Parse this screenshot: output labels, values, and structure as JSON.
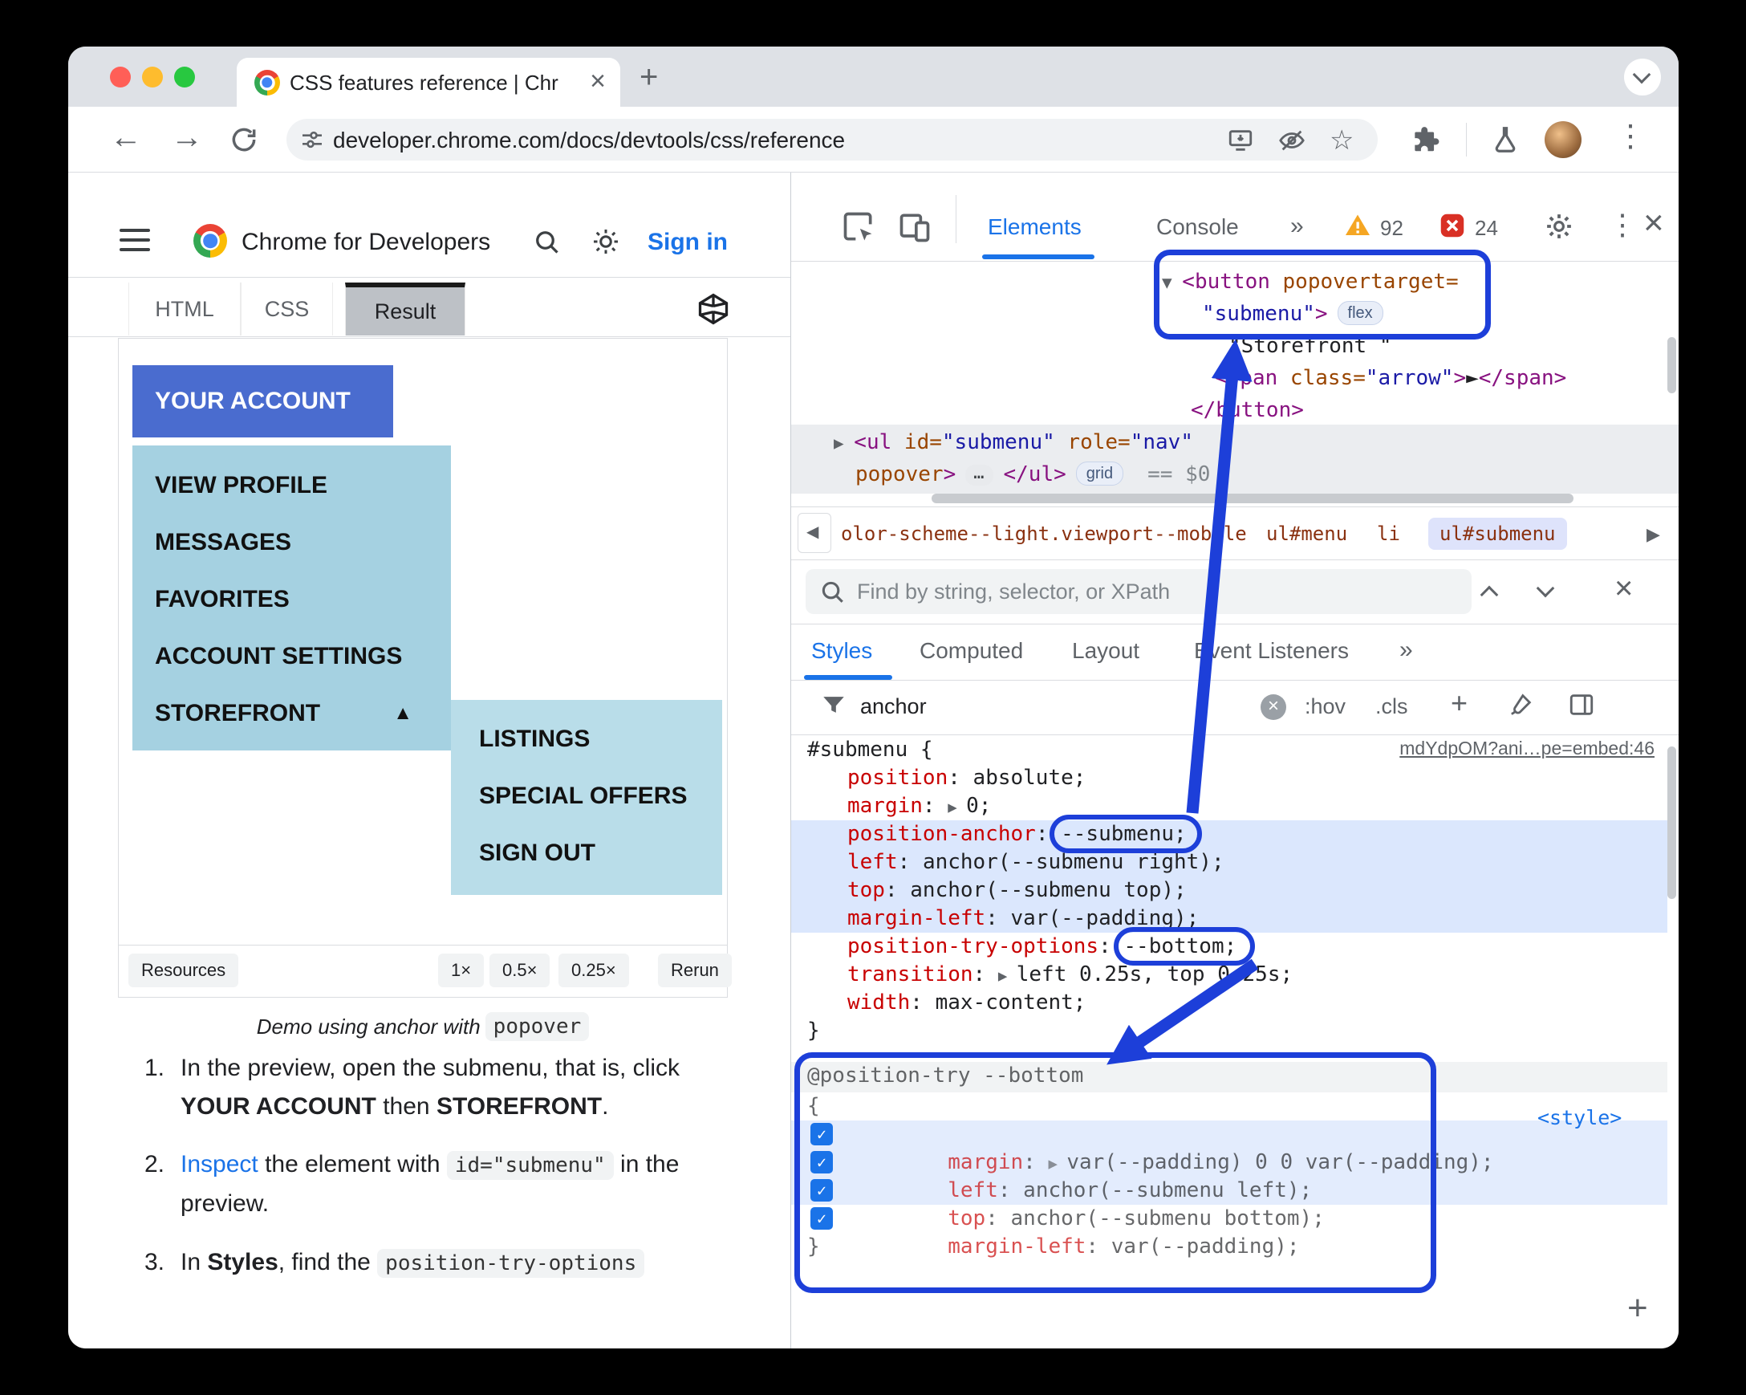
{
  "colors": {
    "annotation_blue": "#1d3fd9",
    "accent_blue": "#1a73e8",
    "account_button_blue": "#4a6ccf",
    "menu_light_blue": "#a5d1e1",
    "submenu_light_blue": "#b9dde9",
    "warning_yellow": "#f5a623",
    "error_red": "#d93025"
  },
  "browser": {
    "tab_title": "CSS features reference | Chr",
    "url": "developer.chrome.com/docs/devtools/css/reference"
  },
  "site": {
    "brand": "Chrome for Developers",
    "sign_in": "Sign in",
    "tabs": {
      "html": "HTML",
      "css": "CSS",
      "result": "Result"
    }
  },
  "demo": {
    "account_button": "YOUR ACCOUNT",
    "menu_items": [
      "VIEW PROFILE",
      "MESSAGES",
      "FAVORITES",
      "ACCOUNT SETTINGS",
      "STOREFRONT"
    ],
    "storefront_caret": "▲",
    "submenu_items": [
      "LISTINGS",
      "SPECIAL OFFERS",
      "SIGN OUT"
    ],
    "resources": "Resources",
    "scales": [
      "1×",
      "0.5×",
      "0.25×"
    ],
    "rerun": "Rerun",
    "caption": [
      {
        "t": "Demo using anchor with ",
        "c": "italic"
      },
      {
        "t": "popover",
        "c": "chip"
      }
    ]
  },
  "instructions": {
    "items": [
      {
        "num": "1.",
        "lines": [
          [
            {
              "t": "In the preview, open the submenu, that is, click",
              "c": "plain"
            }
          ],
          [
            {
              "t": "YOUR ACCOUNT",
              "c": "bold"
            },
            {
              "t": " then ",
              "c": "plain"
            },
            {
              "t": "STOREFRONT",
              "c": "bold"
            },
            {
              "t": ".",
              "c": "pl ain"
            }
          ]
        ]
      },
      {
        "num": "2.",
        "lines": [
          [
            {
              "t": "Inspect",
              "c": "link"
            },
            {
              "t": " the element with ",
              "c": "plain"
            },
            {
              "t": "id=\"submenu\"",
              "c": "chip"
            },
            {
              "t": " in the",
              "c": "plain"
            }
          ],
          [
            {
              "t": "preview.",
              "c": "plain"
            }
          ]
        ]
      },
      {
        "num": "3.",
        "lines": [
          [
            {
              "t": "In ",
              "c": "plain"
            },
            {
              "t": "Styles",
              "c": "bold"
            },
            {
              "t": ", find the ",
              "c": "plain"
            },
            {
              "t": "position-try-options",
              "c": "chip"
            }
          ]
        ]
      }
    ]
  },
  "devtools": {
    "tabs": {
      "elements": "Elements",
      "console": "Console",
      "more": "»"
    },
    "warning_count": "92",
    "error_count": "24",
    "elements_tree": {
      "lines": [
        [
          {
            "t": "▼ ",
            "c": "arrow"
          },
          {
            "t": "<button",
            "c": "tag"
          },
          {
            "t": " popovertarget=",
            "c": "attr"
          }
        ],
        [
          {
            "t": "\"submenu\"",
            "c": "val"
          },
          {
            "t": ">",
            "c": "tag"
          },
          {
            "t": "flex",
            "c": "badge"
          }
        ],
        [
          {
            "t": "\"Storefront \"",
            "c": "text"
          }
        ],
        [
          {
            "t": "<span",
            "c": "tag"
          },
          {
            "t": " class=",
            "c": "attr"
          },
          {
            "t": "\"arrow\"",
            "c": "val"
          },
          {
            "t": ">",
            "c": "tag"
          },
          {
            "t": "►",
            "c": "text"
          },
          {
            "t": "</span>",
            "c": "tag"
          }
        ],
        [
          {
            "t": "</button>",
            "c": "tag"
          }
        ],
        [
          {
            "t": "▶ ",
            "c": "arrow"
          },
          {
            "t": "<ul",
            "c": "tag"
          },
          {
            "t": " id=",
            "c": "attr"
          },
          {
            "t": "\"submenu\"",
            "c": "val"
          },
          {
            "t": " role=",
            "c": "attr"
          },
          {
            "t": "\"nav\"",
            "c": "val"
          }
        ],
        [
          {
            "t": "popover",
            "c": "attr"
          },
          {
            "t": ">",
            "c": "tag"
          },
          {
            "t": "…",
            "c": "badge-dots"
          },
          {
            "t": "</ul>",
            "c": "tag"
          },
          {
            "t": "grid",
            "c": "badge"
          },
          {
            "t": "== $0",
            "c": "eq"
          }
        ]
      ]
    },
    "breadcrumbs": {
      "items": [
        "olor-scheme--light.viewport--mobile",
        "ul#menu",
        "li",
        "ul#submenu"
      ]
    },
    "find": {
      "placeholder": "Find by string, selector, or XPath"
    },
    "sidebar_tabs": {
      "styles": "Styles",
      "computed": "Computed",
      "layout": "Layout",
      "event_listeners": "Event Listeners",
      "more": "»"
    },
    "filter": {
      "text": "anchor",
      "hov": ":hov",
      "cls": ".cls",
      "plus": "+"
    },
    "rule": {
      "link": "mdYdpOM?ani…pe=embed:46",
      "lines": [
        [
          {
            "t": "#submenu {",
            "c": "code"
          }
        ],
        [
          {
            "t": "position",
            "c": "prop"
          },
          {
            "t": ": absolute;",
            "c": "code"
          }
        ],
        [
          {
            "t": "margin",
            "c": "prop"
          },
          {
            "t": ": ",
            "c": "code"
          },
          {
            "t": "▶ ",
            "c": "tri"
          },
          {
            "t": "0;",
            "c": "code"
          }
        ],
        [
          {
            "t": "position-anchor",
            "c": "prop"
          },
          {
            "t": ": ",
            "c": "code"
          },
          {
            "t": "--submenu;",
            "c": "code"
          }
        ],
        [
          {
            "t": "left",
            "c": "prop"
          },
          {
            "t": ": ",
            "c": "code"
          },
          {
            "t": "anchor(--submenu right);",
            "c": "code"
          }
        ],
        [
          {
            "t": "top",
            "c": "prop"
          },
          {
            "t": ": ",
            "c": "code"
          },
          {
            "t": "anchor(--submenu top);",
            "c": "code"
          }
        ],
        [
          {
            "t": "margin-left",
            "c": "prop"
          },
          {
            "t": ": ",
            "c": "code"
          },
          {
            "t": "var(--padding);",
            "c": "code"
          }
        ],
        [
          {
            "t": "position-try-options",
            "c": "prop"
          },
          {
            "t": ": ",
            "c": "code"
          },
          {
            "t": "--bottom;",
            "c": "code"
          }
        ],
        [
          {
            "t": "transition",
            "c": "prop"
          },
          {
            "t": ": ",
            "c": "code"
          },
          {
            "t": "▶ ",
            "c": "tri"
          },
          {
            "t": "left 0.25s, top 0.25s;",
            "c": "code"
          }
        ],
        [
          {
            "t": "width",
            "c": "prop"
          },
          {
            "t": ": ",
            "c": "code"
          },
          {
            "t": "max-content;",
            "c": "code"
          }
        ],
        [
          {
            "t": "}",
            "c": "code"
          }
        ]
      ]
    },
    "position_try": {
      "style_link": "<style>",
      "add": "+",
      "lines": [
        [
          {
            "t": "@position-try --bottom",
            "c": "code"
          }
        ],
        [
          {
            "t": "{",
            "c": "code"
          }
        ],
        [
          {
            "t": "margin",
            "c": "prop"
          },
          {
            "t": ": ",
            "c": "code"
          },
          {
            "t": "▶ ",
            "c": "tri"
          },
          {
            "t": "var(--padding) 0 0 var(--padding);",
            "c": "code"
          }
        ],
        [
          {
            "t": "left",
            "c": "prop"
          },
          {
            "t": ": ",
            "c": "code"
          },
          {
            "t": "anchor(--submenu left);",
            "c": "code"
          }
        ],
        [
          {
            "t": "top",
            "c": "prop"
          },
          {
            "t": ": ",
            "c": "code"
          },
          {
            "t": "anchor(--submenu bottom);",
            "c": "code"
          }
        ],
        [
          {
            "t": "margin-left",
            "c": "prop"
          },
          {
            "t": ": ",
            "c": "code"
          },
          {
            "t": "var(--padding);",
            "c": "code"
          }
        ],
        [
          {
            "t": "}",
            "c": "code"
          }
        ]
      ]
    }
  }
}
